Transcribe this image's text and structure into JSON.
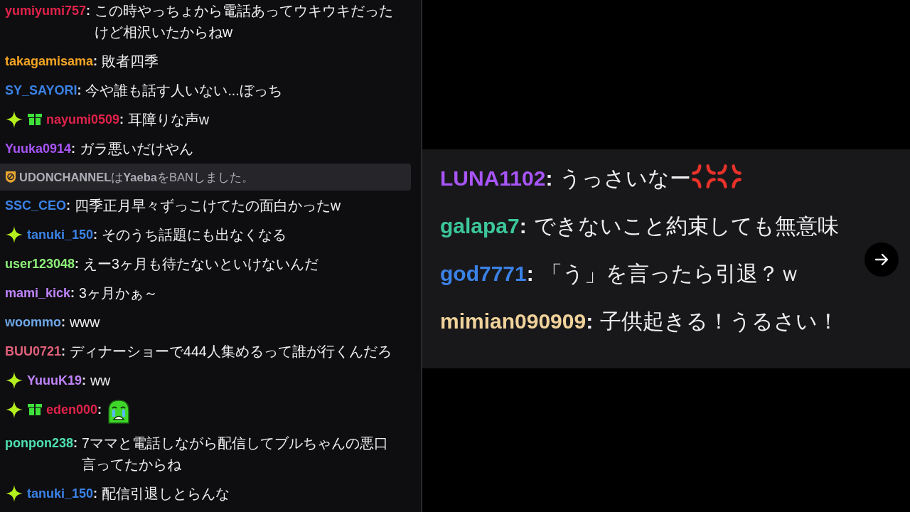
{
  "chat": {
    "messages": [
      {
        "kind": "message",
        "user": "yumiyumi757",
        "separator": ":",
        "color": "#e0224a",
        "text": "この時やっちょから電話あってウキウキだったけど相沢いたからねw"
      },
      {
        "kind": "message",
        "user": "takagamisama",
        "separator": ":",
        "color": "#f5a623",
        "text": "敗者四季"
      },
      {
        "kind": "message",
        "user": "SY_SAYORI",
        "separator": ":",
        "color": "#3b82e6",
        "text": "今や誰も話す人いない...ぼっち"
      },
      {
        "kind": "message",
        "badges": [
          {
            "kind": "sparkle"
          },
          {
            "kind": "gift"
          }
        ],
        "user": "nayumi0509",
        "separator": ":",
        "color": "#e0224a",
        "text": "耳障りな声w"
      },
      {
        "kind": "message",
        "user": "Yuuka0914",
        "separator": ":",
        "color": "#a855f7",
        "text": "ガラ悪いだけやん"
      },
      {
        "kind": "notice",
        "text": "**UDONCHANNEL**は**Yaeba**をBANしました。"
      },
      {
        "kind": "message",
        "user": "SSC_CEO",
        "separator": ":",
        "color": "#3b82e6",
        "text": "四季正月早々ずっこけてたの面白かったw"
      },
      {
        "kind": "message",
        "badges": [
          {
            "kind": "sparkle"
          }
        ],
        "user": "tanuki_150",
        "separator": ":",
        "color": "#3b82e6",
        "text": "そのうち話題にも出なくなる"
      },
      {
        "kind": "message",
        "user": "user123048",
        "separator": ":",
        "color": "#8ef07a",
        "text": "えー3ヶ月も待たないといけないんだ"
      },
      {
        "kind": "message",
        "user": "mami_kick",
        "separator": ":",
        "color": "#c084fc",
        "text": "3ヶ月かぁ～"
      },
      {
        "kind": "message",
        "user": "woommo",
        "separator": ":",
        "color": "#6ea8e8",
        "text": "www"
      },
      {
        "kind": "message",
        "user": "BUU0721",
        "separator": ":",
        "color": "#e0607a",
        "text": "ディナーショーで444人集めるって誰が行くんだろ"
      },
      {
        "kind": "message",
        "badges": [
          {
            "kind": "sparkle"
          }
        ],
        "user": "YuuuK19",
        "separator": ":",
        "color": "#c084fc",
        "text": "ww"
      },
      {
        "kind": "message",
        "badges": [
          {
            "kind": "sparkle"
          },
          {
            "kind": "gift"
          }
        ],
        "user": "eden000",
        "separator": ":",
        "color": "#e0224a",
        "emotes": [
          {
            "kind": "crying"
          }
        ]
      },
      {
        "kind": "message",
        "user": "ponpon238",
        "separator": ":",
        "color": "#4fe0b0",
        "text": "7ママと電話しながら配信してブルちゃんの悪口言ってたからね"
      },
      {
        "kind": "message",
        "badges": [
          {
            "kind": "sparkle"
          }
        ],
        "user": "tanuki_150",
        "separator": ":",
        "color": "#3b82e6",
        "text": "配信引退しとらんな"
      }
    ]
  },
  "overlay": {
    "messages": [
      {
        "user": "LUNA1102",
        "separator": ":",
        "color": "#a855f7",
        "text": "うっさいなー",
        "emotes": [
          {
            "kind": "anger"
          },
          {
            "kind": "anger"
          }
        ]
      },
      {
        "user": "galapa7",
        "separator": ":",
        "color": "#3cc79a",
        "text": "できないこと約束しても無意味"
      },
      {
        "user": "god7771",
        "separator": ":",
        "color": "#3b82e6",
        "text": "「う」を言ったら引退？ｗ"
      },
      {
        "user": "mimian090909",
        "separator": ":",
        "color": "#f0d29a",
        "text": "子供起きる！うるさい！"
      }
    ]
  }
}
